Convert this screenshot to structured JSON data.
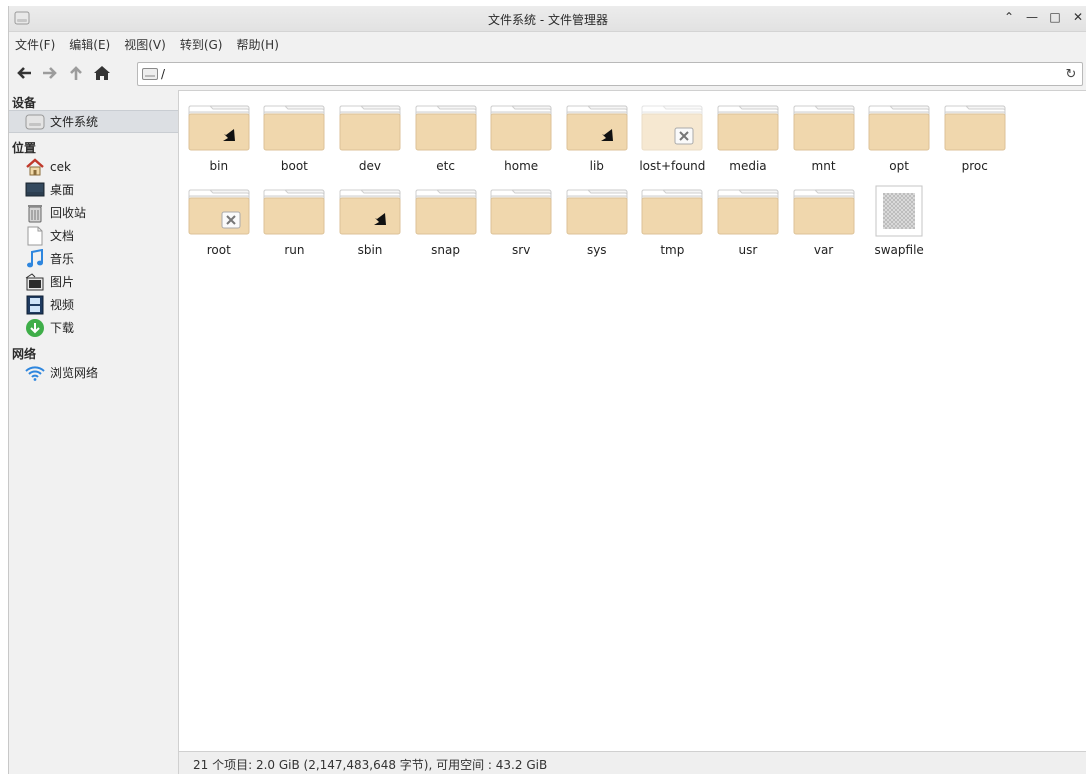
{
  "window": {
    "title": "文件系统 - 文件管理器"
  },
  "menubar": [
    "文件(F)",
    "编辑(E)",
    "视图(V)",
    "转到(G)",
    "帮助(H)"
  ],
  "location": {
    "path": "/"
  },
  "sidebar": {
    "devices_title": "设备",
    "devices": [
      {
        "label": "文件系统",
        "icon": "drive-icon",
        "active": true
      }
    ],
    "places_title": "位置",
    "places": [
      {
        "label": "cek",
        "icon": "home-icon"
      },
      {
        "label": "桌面",
        "icon": "desktop-icon"
      },
      {
        "label": "回收站",
        "icon": "trash-icon"
      },
      {
        "label": "文档",
        "icon": "document-icon"
      },
      {
        "label": "音乐",
        "icon": "music-icon"
      },
      {
        "label": "图片",
        "icon": "pictures-icon"
      },
      {
        "label": "视频",
        "icon": "video-icon"
      },
      {
        "label": "下载",
        "icon": "download-icon"
      }
    ],
    "network_title": "网络",
    "network": [
      {
        "label": "浏览网络",
        "icon": "wifi-icon"
      }
    ]
  },
  "files": [
    {
      "name": "bin",
      "type": "folder",
      "badge": "link"
    },
    {
      "name": "boot",
      "type": "folder"
    },
    {
      "name": "dev",
      "type": "folder"
    },
    {
      "name": "etc",
      "type": "folder"
    },
    {
      "name": "home",
      "type": "folder"
    },
    {
      "name": "lib",
      "type": "folder",
      "badge": "link"
    },
    {
      "name": "lost+found",
      "type": "folder",
      "badge": "locked",
      "faded": true
    },
    {
      "name": "media",
      "type": "folder"
    },
    {
      "name": "mnt",
      "type": "folder"
    },
    {
      "name": "opt",
      "type": "folder"
    },
    {
      "name": "proc",
      "type": "folder"
    },
    {
      "name": "root",
      "type": "folder",
      "badge": "locked"
    },
    {
      "name": "run",
      "type": "folder"
    },
    {
      "name": "sbin",
      "type": "folder",
      "badge": "link"
    },
    {
      "name": "snap",
      "type": "folder"
    },
    {
      "name": "srv",
      "type": "folder"
    },
    {
      "name": "sys",
      "type": "folder"
    },
    {
      "name": "tmp",
      "type": "folder"
    },
    {
      "name": "usr",
      "type": "folder"
    },
    {
      "name": "var",
      "type": "folder"
    },
    {
      "name": "swapfile",
      "type": "file"
    }
  ],
  "status": "21 个项目: 2.0 GiB (2,147,483,648 字节), 可用空间 : 43.2 GiB"
}
